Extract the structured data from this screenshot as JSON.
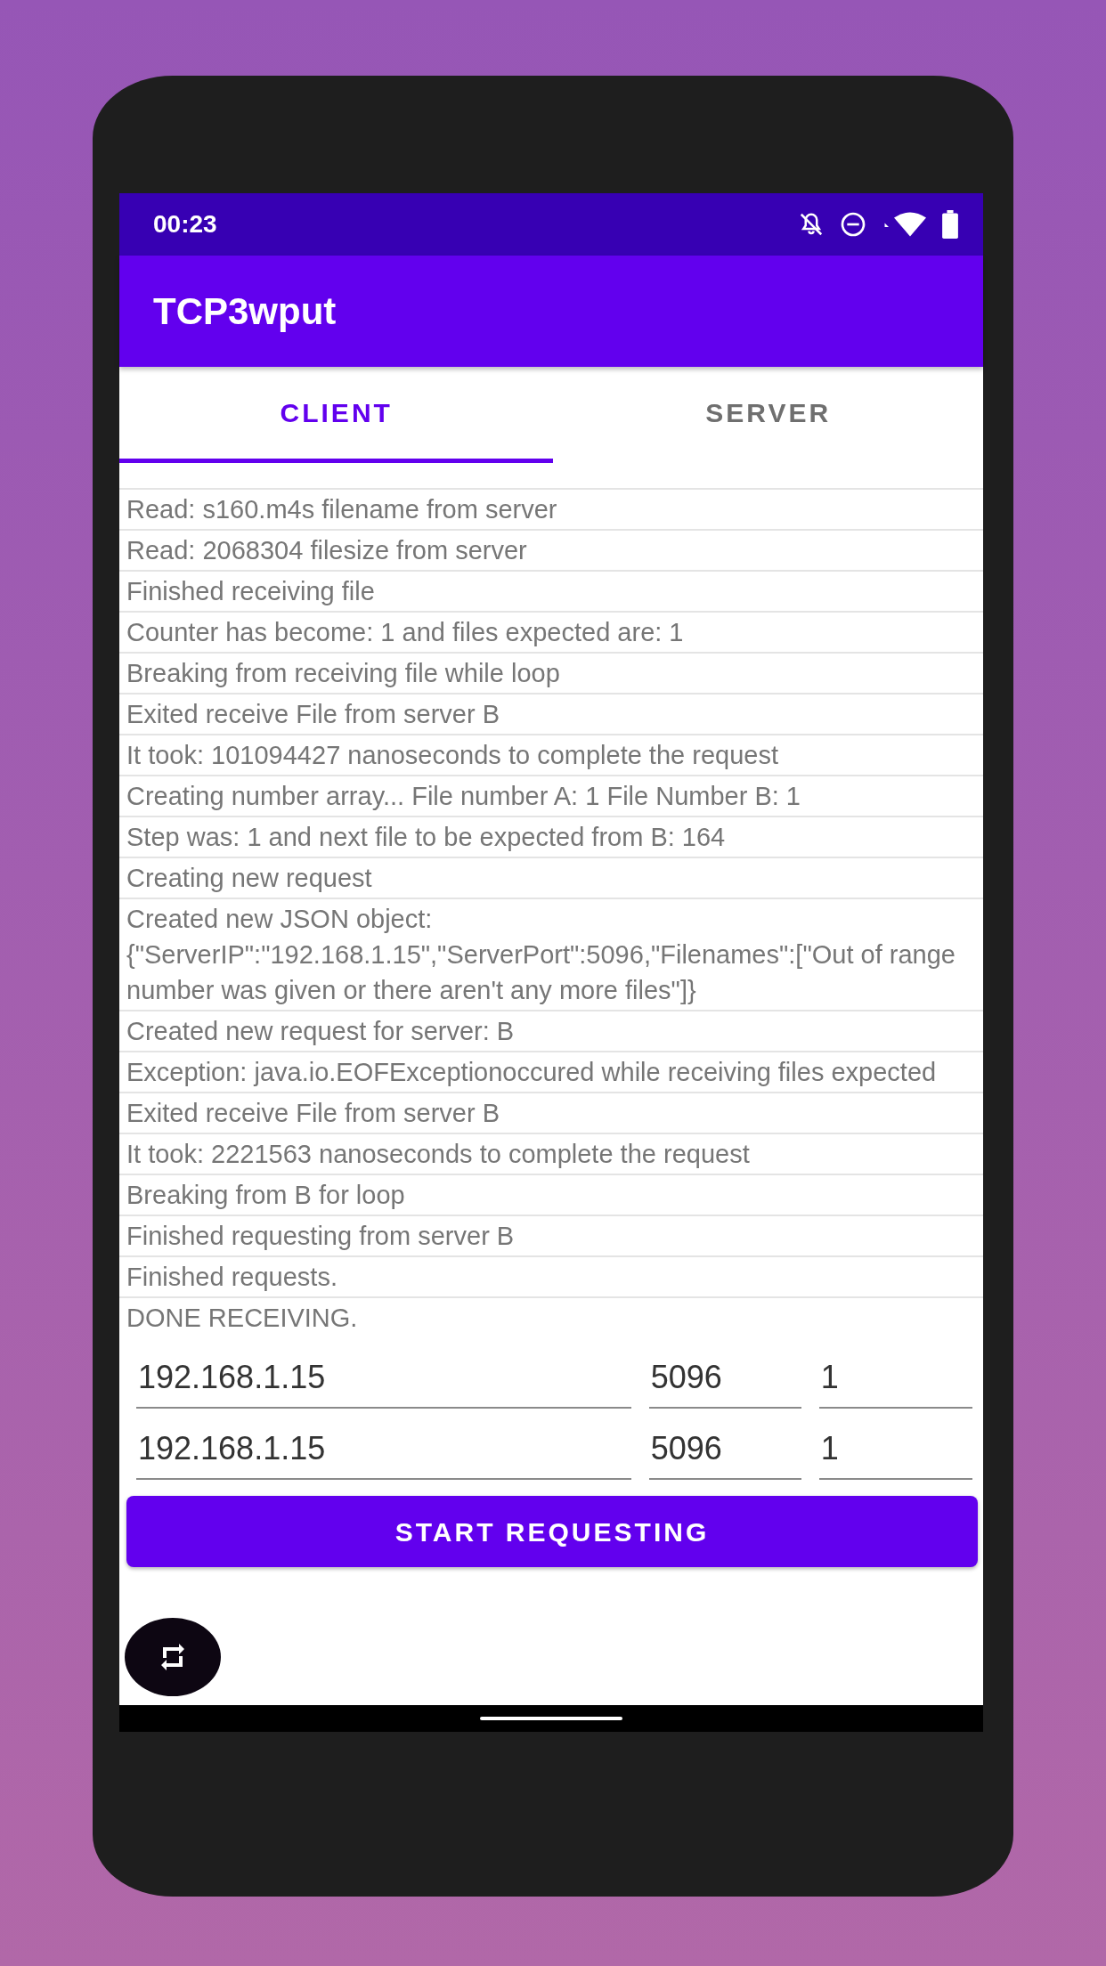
{
  "status_bar": {
    "time": "00:23"
  },
  "app_bar": {
    "title": "TCP3wput"
  },
  "tabs": [
    {
      "label": "CLIENT",
      "selected": true
    },
    {
      "label": "SERVER",
      "selected": false
    }
  ],
  "log": [
    "Read: s160.m4s filename from server",
    "Read: 2068304 filesize from server",
    "Finished receiving file",
    "Counter has become: 1 and files expected are: 1",
    "Breaking from receiving file while loop",
    "Exited receive File from server B",
    "It took: 101094427 nanoseconds to complete the request",
    "Creating number array... File number A: 1 File Number B: 1",
    "Step was: 1 and next file to be expected from B: 164",
    "Creating new request",
    "Created new JSON object: {\"ServerIP\":\"192.168.1.15\",\"ServerPort\":5096,\"Filenames\":[\"Out of range number was given or there aren't any more files\"]}",
    "Created new request for server: B",
    "Exception: java.io.EOFExceptionoccured while receiving files expected",
    "Exited receive File from server B",
    "It took: 2221563 nanoseconds to complete the request",
    "Breaking from B for loop",
    "Finished requesting from server B",
    "Finished requests.",
    "DONE RECEIVING."
  ],
  "servers": [
    {
      "ip": "192.168.1.15",
      "port": "5096",
      "count": "1"
    },
    {
      "ip": "192.168.1.15",
      "port": "5096",
      "count": "1"
    }
  ],
  "start_button": {
    "label": "START REQUESTING"
  }
}
